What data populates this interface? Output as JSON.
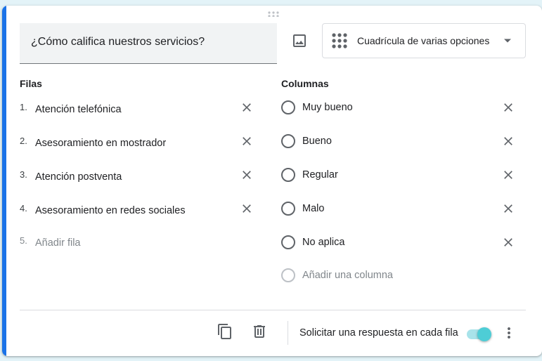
{
  "question": {
    "title": "¿Cómo califica nuestros servicios?",
    "type_label": "Cuadrícula de varias opciones",
    "icons": {
      "image": "image-icon",
      "type": "grid-dots-icon",
      "dropdown": "arrow-drop-down-icon",
      "drag": "drag-handle-icon"
    }
  },
  "rows": {
    "title": "Filas",
    "items": [
      {
        "num": "1.",
        "label": "Atención telefónica"
      },
      {
        "num": "2.",
        "label": "Asesoramiento en mostrador"
      },
      {
        "num": "3.",
        "label": "Atención postventa"
      },
      {
        "num": "4.",
        "label": "Asesoramiento en redes sociales"
      }
    ],
    "add": {
      "num": "5.",
      "label": "Añadir fila"
    }
  },
  "columns": {
    "title": "Columnas",
    "items": [
      {
        "label": "Muy bueno"
      },
      {
        "label": "Bueno"
      },
      {
        "label": "Regular"
      },
      {
        "label": "Malo"
      },
      {
        "label": "No aplica"
      }
    ],
    "add": {
      "label": "Añadir una columna"
    }
  },
  "footer": {
    "require_label": "Solicitar una respuesta en cada fila",
    "require_enabled": true,
    "icons": {
      "duplicate": "copy-icon",
      "delete": "trash-icon",
      "more": "more-vert-icon"
    }
  },
  "colors": {
    "accent": "#1a73e8",
    "toggle_thumb": "#4ecdd6",
    "toggle_track": "#a8e3ea",
    "background": "#e3f3f8"
  }
}
